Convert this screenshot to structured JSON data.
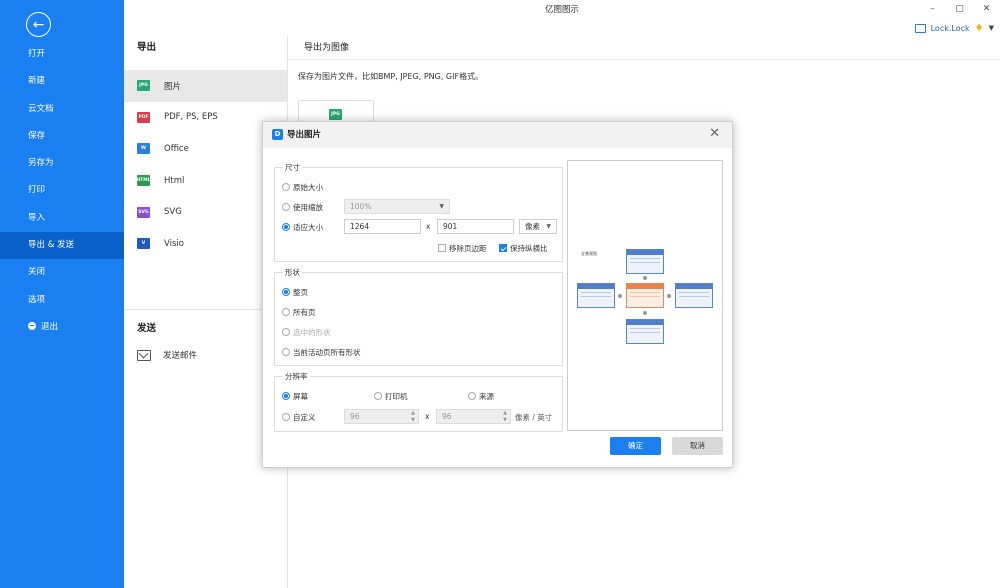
{
  "app": {
    "title": "亿图图示",
    "window_controls": [
      "–",
      "▢",
      "✕"
    ],
    "user": "Lock.Lock"
  },
  "sidebar": {
    "items": [
      {
        "label": "打开"
      },
      {
        "label": "新建"
      },
      {
        "label": "云文档"
      },
      {
        "label": "保存"
      },
      {
        "label": "另存为"
      },
      {
        "label": "打印"
      },
      {
        "label": "导入"
      },
      {
        "label": "导出 & 发送",
        "active": true
      },
      {
        "label": "关闭"
      },
      {
        "label": "选项"
      },
      {
        "label": "退出"
      }
    ]
  },
  "export": {
    "title": "导出",
    "formats": [
      {
        "label": "图片",
        "badge": "JPG"
      },
      {
        "label": "PDF, PS, EPS",
        "badge": "PDF"
      },
      {
        "label": "Office",
        "badge": "W"
      },
      {
        "label": "Html",
        "badge": "HTML"
      },
      {
        "label": "SVG",
        "badge": "SVG"
      },
      {
        "label": "Visio",
        "badge": "V"
      }
    ],
    "send_title": "发送",
    "send_item": "发送邮件"
  },
  "right": {
    "title": "导出为图像",
    "desc": "保存为图片文件，比如BMP, JPEG, PNG, GIF格式。",
    "thumb_badge": "JPG"
  },
  "dialog": {
    "title": "导出图片",
    "size": {
      "label": "尺寸",
      "original": "原始大小",
      "zoom": "使用缩放",
      "zoom_value": "100%",
      "fit": "适应大小",
      "width": "1264",
      "height": "901",
      "x": "x",
      "unit": "像素",
      "remove_margin": "移除页边距",
      "keep_ratio": "保持纵横比"
    },
    "shape": {
      "label": "形状",
      "whole_page": "整页",
      "all_pages": "所有页",
      "selected": "选中的形状",
      "current_all": "当前活动页所有形状"
    },
    "resolution": {
      "label": "分辨率",
      "screen": "屏幕",
      "printer": "打印机",
      "source": "来源",
      "custom": "自定义",
      "dpi_x": "96",
      "dpi_y": "96",
      "x": "x",
      "unit": "像素 / 英寸"
    },
    "preview": {
      "doc_title": "全景视图"
    },
    "ok": "确定",
    "cancel": "取消"
  }
}
